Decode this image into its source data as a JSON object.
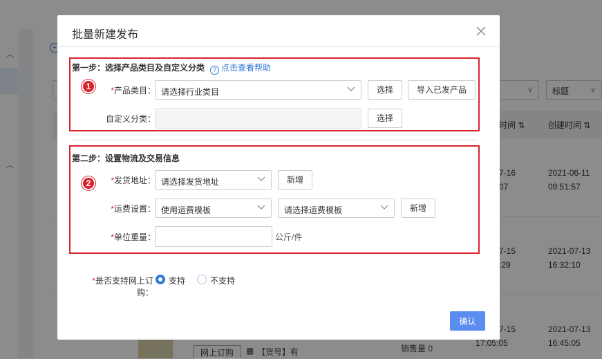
{
  "background": {
    "filter_select": {
      "value": "标题"
    },
    "table_headers": {
      "col_a": "时间 ⇅",
      "col_b": "创建时间 ⇅"
    },
    "rows": [
      {
        "a1": "7-16",
        "a2": "07",
        "b1": "2021-06-11",
        "b2": "09:51:57"
      },
      {
        "a1": "7-15",
        "a2": ":29",
        "b1": "2021-07-13",
        "b2": "16:32:10"
      },
      {
        "a1": "7-15",
        "a2": "17:05:05",
        "b1": "2021-07-13",
        "b2": "16:45:05"
      }
    ],
    "footer": {
      "order_tag": "网上订购",
      "sku_text": "【货号】有",
      "sales": "销售量 0"
    }
  },
  "modal": {
    "title": "批量新建发布",
    "step1": {
      "title": "第一步：选择产品类目及自定义分类",
      "help": "点击查看帮助",
      "badge": "1",
      "category_label": "产品类目：",
      "category_placeholder": "请选择行业类目",
      "select_button": "选择",
      "import_button": "导入已发产品",
      "custom_label": "自定义分类：",
      "custom_value": "",
      "custom_select_button": "选择"
    },
    "step2": {
      "title": "第二步：设置物流及交易信息",
      "badge": "2",
      "address_label": "发货地址：",
      "address_placeholder": "请选择发货地址",
      "address_add": "新增",
      "freight_label": "运费设置：",
      "freight_mode": "使用运费模板",
      "freight_template": "请选择运费模板",
      "freight_add": "新增",
      "weight_label": "单位重量：",
      "weight_value": "",
      "weight_unit": "公斤/件"
    },
    "online_order": {
      "label": "是否支持网上订购：",
      "options": [
        "支持",
        "不支持"
      ],
      "selected": "支持"
    },
    "confirm": "确认"
  },
  "colors": {
    "accent": "#2f7bd9",
    "annotation_red": "#d9232c",
    "confirm": "#5b8cf0"
  }
}
